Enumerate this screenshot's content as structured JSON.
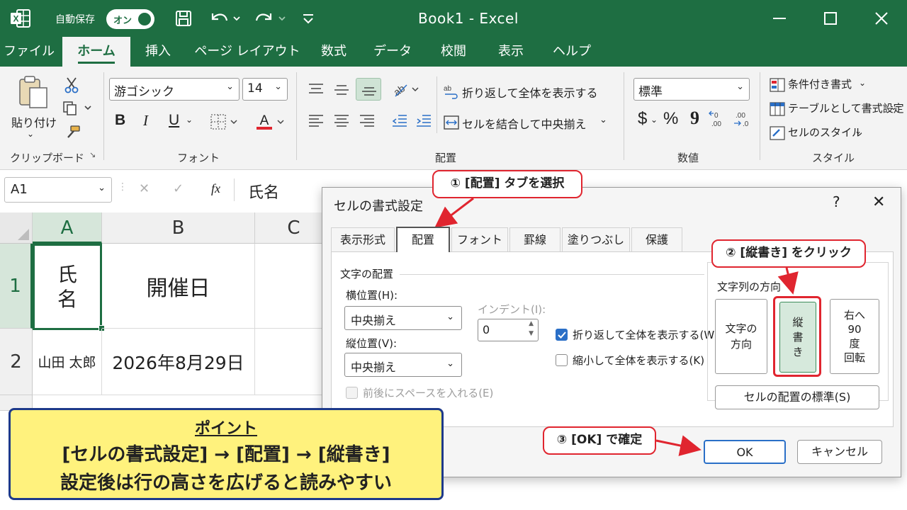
{
  "titlebar": {
    "autosave_label": "自動保存",
    "toggle_label": "オン",
    "doc_title": "Book1  -  Excel"
  },
  "ribbon_tabs": [
    "ファイル",
    "ホーム",
    "挿入",
    "ページ レイアウト",
    "数式",
    "データ",
    "校閲",
    "表示",
    "ヘルプ"
  ],
  "active_tab": "ホーム",
  "clipboard": {
    "paste_label": "貼り付け",
    "group_label": "クリップボード"
  },
  "font": {
    "name": "游ゴシック",
    "size": "14",
    "bold": "B",
    "italic": "I",
    "underline": "U",
    "group_label": "フォント"
  },
  "alignment": {
    "wrap_label": "折り返して全体を表示する",
    "merge_label": "セルを結合して中央揃え",
    "group_label": "配置"
  },
  "number": {
    "format": "標準",
    "currency": "$",
    "percent": "%",
    "comma": "9",
    "group_label": "数値"
  },
  "styles": {
    "conditional": "条件付き書式",
    "as_table": "テーブルとして書式設定",
    "cell_styles": "セルのスタイル",
    "group_label": "スタイル"
  },
  "formula_bar": {
    "name_box": "A1",
    "fx": "fx",
    "content": "氏名"
  },
  "grid": {
    "columns": [
      "A",
      "B",
      "C"
    ],
    "rows": [
      "1",
      "2"
    ],
    "a1_chars": [
      "氏",
      "名"
    ],
    "b1": "開催日",
    "a2": "山田 太郎",
    "b2": "2026年8月29日"
  },
  "dialog": {
    "title": "セルの書式設定",
    "help": "?",
    "close": "✕",
    "tabs": [
      "表示形式",
      "配置",
      "フォント",
      "罫線",
      "塗りつぶし",
      "保護"
    ],
    "active_tab": "配置",
    "text_alignment_section": "文字の配置",
    "horizontal_label": "横位置(H):",
    "horizontal_value": "中央揃え",
    "indent_label": "インデント(I):",
    "indent_value": "0",
    "vertical_label": "縦位置(V):",
    "vertical_value": "中央揃え",
    "justify_distributed_label": "前後にスペースを入れる(E)",
    "wrap_text_label": "折り返して全体を表示する(W)",
    "wrap_text_checked": true,
    "shrink_label": "縮小して全体を表示する(K)",
    "shrink_checked": false,
    "orientation_section": "文字列の方向",
    "orientation_text_btn": [
      "文字の",
      "方向"
    ],
    "orientation_vertical_btn": [
      "縦",
      "書",
      "き"
    ],
    "orientation_rotate_btn": [
      "右へ",
      "90",
      "度",
      "回転"
    ],
    "reset_btn": "セルの配置の標準(S)",
    "ok_btn": "OK",
    "cancel_btn": "キャンセル"
  },
  "annotations": {
    "step1": "① [配置] タブを選択",
    "step2": "② [縦書き] をクリック",
    "step3": "③ [OK] で確定",
    "accent_color": "#e0252f"
  },
  "point_box": {
    "title": "ポイント",
    "line1": "[セルの書式設定] → [配置] → [縦書き]",
    "line2": "設定後は行の高さを広げると読みやすい"
  },
  "colors": {
    "excel_green": "#1e6e42",
    "point_bg": "#fff27d",
    "point_border": "#1e3a8a"
  }
}
